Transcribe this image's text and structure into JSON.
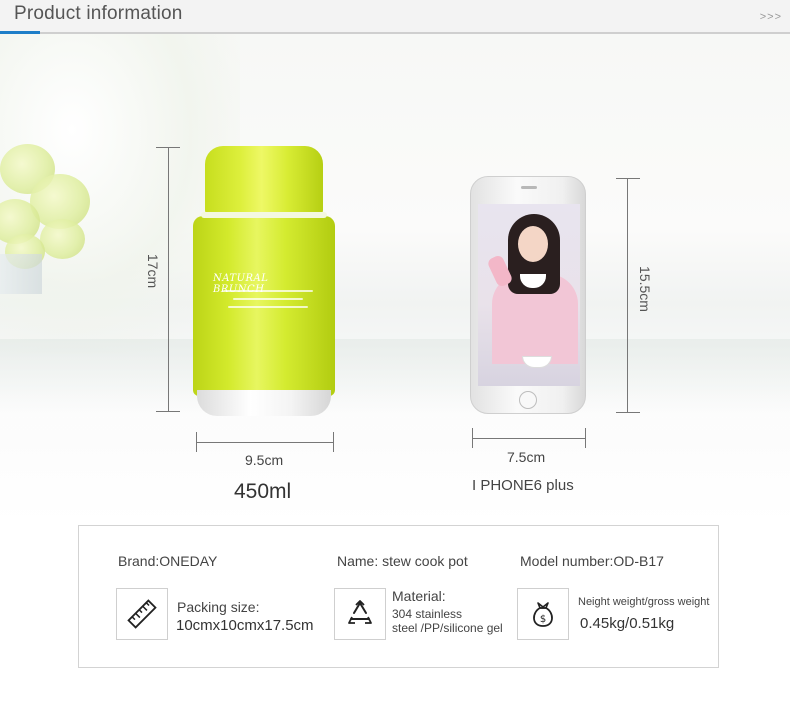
{
  "header": {
    "title": "Product information",
    "arrows": ">>>"
  },
  "products": {
    "pot": {
      "height_label": "17cm",
      "width_label": "9.5cm",
      "capacity": "450ml",
      "brand_print": "NATURAL BRUNCH"
    },
    "phone": {
      "height_label": "15.5cm",
      "width_label": "7.5cm",
      "model": "I PHONE6 plus"
    }
  },
  "specs": {
    "brand": "Brand:ONEDAY",
    "name": "Name: stew cook pot",
    "model_number": "Model number:OD-B17",
    "packing_label": "Packing size:",
    "packing_value": "10cmx10cmx17.5cm",
    "material_label": "Material:",
    "material_line1": "304 stainless",
    "material_line2": "steel /PP/silicone gel",
    "weight_label": "Neight weight/gross weight",
    "weight_value": "0.45kg/0.51kg"
  },
  "icons": {
    "ruler": "ruler-icon",
    "recycle": "recycle-icon",
    "weight_bag": "weight-bag-icon"
  },
  "colors": {
    "accent_blue": "#1e7ec8",
    "pot_green": "#d3ea2c",
    "header_bg": "#f3f3f3"
  }
}
